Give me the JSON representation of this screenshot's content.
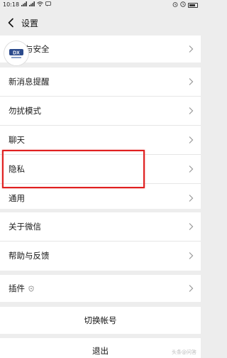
{
  "status_bar": {
    "time": "10:18",
    "left_icons": [
      "signal-icon",
      "signal-icon",
      "wifi-icon",
      "message-icon"
    ],
    "right_icons": [
      "alarm-icon",
      "clock-icon",
      "battery-icon"
    ]
  },
  "header": {
    "title": "设置"
  },
  "groups": [
    {
      "items": [
        {
          "label": "帐号与安全"
        }
      ]
    },
    {
      "items": [
        {
          "label": "新消息提醒"
        },
        {
          "label": "勿扰模式"
        },
        {
          "label": "聊天"
        },
        {
          "label": "隐私"
        },
        {
          "label": "通用"
        }
      ]
    },
    {
      "items": [
        {
          "label": "关于微信"
        },
        {
          "label": "帮助与反馈"
        }
      ]
    },
    {
      "items": [
        {
          "label": "插件"
        }
      ]
    }
  ],
  "actions": {
    "switch_account": "切换帐号",
    "logout": "退出"
  },
  "watermark": {
    "text": "头条@问答"
  },
  "colors": {
    "background": "#ededed",
    "highlight": "#e02020",
    "row": "#ffffff"
  }
}
